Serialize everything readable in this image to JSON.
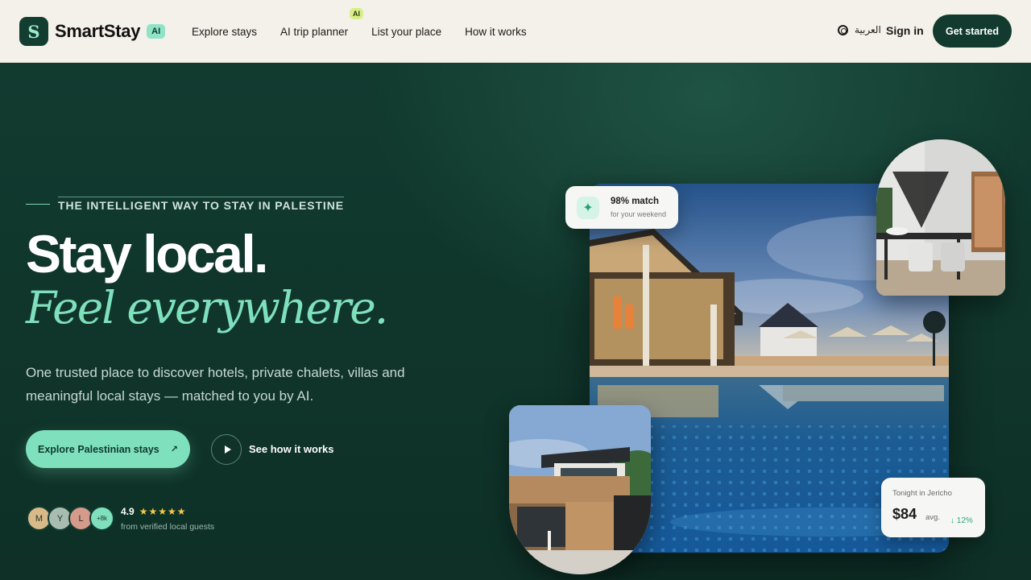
{
  "brand": {
    "mark": "S",
    "name": "SmartStay",
    "badge": "AI"
  },
  "nav": {
    "links": [
      "Explore stays",
      "AI trip planner",
      "List your place",
      "How it works"
    ],
    "ai_chip": "AI",
    "language": "العربية",
    "sign_in": "Sign in",
    "get_started": "Get started"
  },
  "hero": {
    "eyebrow": "THE INTELLIGENT WAY TO STAY IN PALESTINE",
    "headline": "Stay local.",
    "headline_accent": "Feel everywhere.",
    "subtitle": "One trusted place to discover hotels, private chalets, villas and meaningful local stays — matched to you by AI.",
    "cta_primary": "Explore Palestinian stays",
    "cta_primary_icon": "↗",
    "cta_secondary": "See how it works"
  },
  "social_proof": {
    "avatars": [
      {
        "initial": "M",
        "color": "#d8b988"
      },
      {
        "initial": "Y",
        "color": "#a8bcb2"
      },
      {
        "initial": "L",
        "color": "#d69a8a"
      },
      {
        "initial": "+8k",
        "color": "#7fe0bd"
      }
    ],
    "rating": "4.9",
    "stars": "★★★★★",
    "caption": "from verified local guests"
  },
  "match_card": {
    "icon": "✦",
    "title": "98% match",
    "subtitle": "for your weekend"
  },
  "price_card": {
    "label": "Tonight in Jericho",
    "price": "$84",
    "unit": "avg.",
    "change": "↓ 12%"
  },
  "colors": {
    "accent": "#7fe0bd",
    "dark": "#123a2f",
    "nav_bg": "#f3f1e9"
  }
}
